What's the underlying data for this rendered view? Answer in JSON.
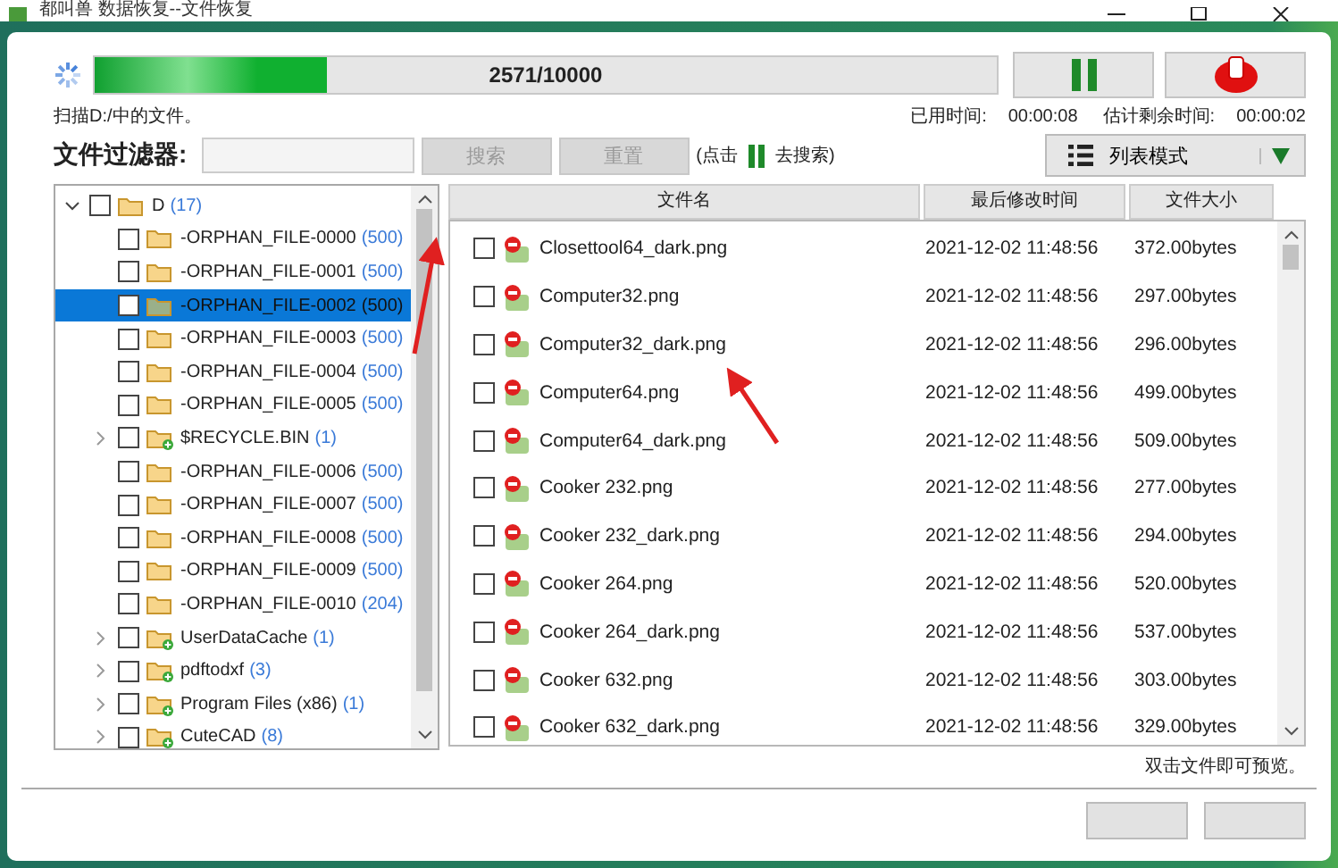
{
  "window": {
    "title": "都叫兽 数据恢复--文件恢复"
  },
  "progress": {
    "level": 0.2571,
    "label": "2571/10000"
  },
  "status": {
    "message": "扫描D:/中的文件。",
    "elapsed_label": "已用时间:",
    "elapsed": "00:00:08",
    "remaining_label": "估计剩余时间:",
    "remaining": "00:00:02"
  },
  "filter": {
    "label": "文件过滤器:",
    "search_button": {
      "label": "搜索",
      "disabled": true
    },
    "reset_button": {
      "label": "重置",
      "disabled": true
    },
    "hint_before": "(点击",
    "hint_after": "去搜索)",
    "view_mode": "列表模式"
  },
  "tree": [
    {
      "name": "D",
      "count": "(17)",
      "expanded": true,
      "checked": false,
      "selected": false,
      "kind": "folder",
      "children": [
        {
          "name": "-ORPHAN_FILE-0000",
          "count": "(500)",
          "checked": false,
          "selected": false,
          "kind": "folder"
        },
        {
          "name": "-ORPHAN_FILE-0001",
          "count": "(500)",
          "checked": false,
          "selected": false,
          "kind": "folder"
        },
        {
          "name": "-ORPHAN_FILE-0002",
          "count": "(500)",
          "checked": false,
          "selected": true,
          "kind": "folder"
        },
        {
          "name": "-ORPHAN_FILE-0003",
          "count": "(500)",
          "checked": false,
          "selected": false,
          "kind": "folder"
        },
        {
          "name": "-ORPHAN_FILE-0004",
          "count": "(500)",
          "checked": false,
          "selected": false,
          "kind": "folder"
        },
        {
          "name": "-ORPHAN_FILE-0005",
          "count": "(500)",
          "checked": false,
          "selected": false,
          "kind": "folder"
        },
        {
          "name": "$RECYCLE.BIN",
          "count": "(1)",
          "checked": false,
          "selected": false,
          "kind": "recovered-folder",
          "expanded": false
        },
        {
          "name": "-ORPHAN_FILE-0006",
          "count": "(500)",
          "checked": false,
          "selected": false,
          "kind": "folder"
        },
        {
          "name": "-ORPHAN_FILE-0007",
          "count": "(500)",
          "checked": false,
          "selected": false,
          "kind": "folder"
        },
        {
          "name": "-ORPHAN_FILE-0008",
          "count": "(500)",
          "checked": false,
          "selected": false,
          "kind": "folder"
        },
        {
          "name": "-ORPHAN_FILE-0009",
          "count": "(500)",
          "checked": false,
          "selected": false,
          "kind": "folder"
        },
        {
          "name": "-ORPHAN_FILE-0010",
          "count": "(204)",
          "checked": false,
          "selected": false,
          "kind": "folder"
        },
        {
          "name": "UserDataCache",
          "count": "(1)",
          "checked": false,
          "selected": false,
          "kind": "recovered-folder",
          "expanded": false
        },
        {
          "name": "pdftodxf",
          "count": "(3)",
          "checked": false,
          "selected": false,
          "kind": "recovered-folder",
          "expanded": false
        },
        {
          "name": "Program Files (x86)",
          "count": "(1)",
          "checked": false,
          "selected": false,
          "kind": "recovered-folder",
          "expanded": false
        },
        {
          "name": "CuteCAD",
          "count": "(8)",
          "checked": false,
          "selected": false,
          "kind": "recovered-folder",
          "expanded": false
        }
      ]
    }
  ],
  "table": {
    "columns": [
      "文件名",
      "最后修改时间",
      "文件大小"
    ],
    "rows": [
      {
        "name": "Closettool64_dark.png",
        "modified": "2021-12-02 11:48:56",
        "size": "372.00bytes",
        "checked": false
      },
      {
        "name": "Computer32.png",
        "modified": "2021-12-02 11:48:56",
        "size": "297.00bytes",
        "checked": false
      },
      {
        "name": "Computer32_dark.png",
        "modified": "2021-12-02 11:48:56",
        "size": "296.00bytes",
        "checked": false
      },
      {
        "name": "Computer64.png",
        "modified": "2021-12-02 11:48:56",
        "size": "499.00bytes",
        "checked": false
      },
      {
        "name": "Computer64_dark.png",
        "modified": "2021-12-02 11:48:56",
        "size": "509.00bytes",
        "checked": false
      },
      {
        "name": "Cooker 232.png",
        "modified": "2021-12-02 11:48:56",
        "size": "277.00bytes",
        "checked": false
      },
      {
        "name": "Cooker 232_dark.png",
        "modified": "2021-12-02 11:48:56",
        "size": "294.00bytes",
        "checked": false
      },
      {
        "name": "Cooker 264.png",
        "modified": "2021-12-02 11:48:56",
        "size": "520.00bytes",
        "checked": false
      },
      {
        "name": "Cooker 264_dark.png",
        "modified": "2021-12-02 11:48:56",
        "size": "537.00bytes",
        "checked": false
      },
      {
        "name": "Cooker 632.png",
        "modified": "2021-12-02 11:48:56",
        "size": "303.00bytes",
        "checked": false
      },
      {
        "name": "Cooker 632_dark.png",
        "modified": "2021-12-02 11:48:56",
        "size": "329.00bytes",
        "checked": false
      }
    ]
  },
  "preview_hint": "双击文件即可预览。"
}
